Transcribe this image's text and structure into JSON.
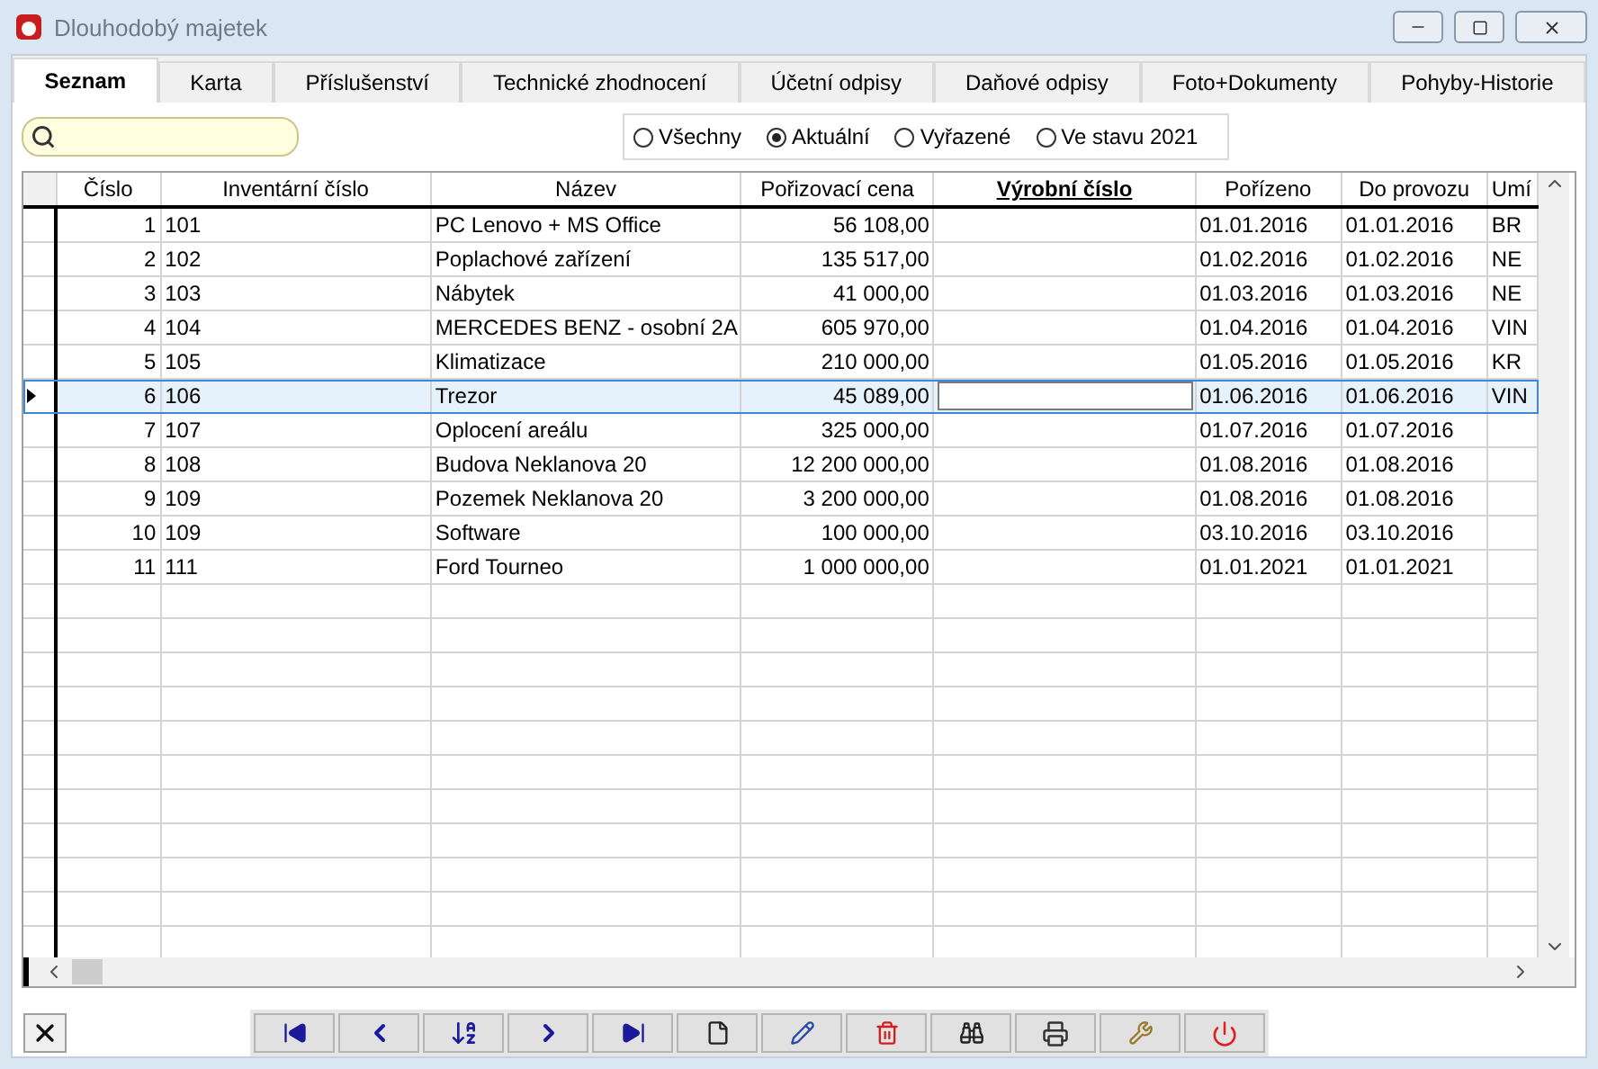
{
  "window": {
    "title": "Dlouhodobý majetek"
  },
  "tabs": [
    {
      "label": "Seznam",
      "selected": true
    },
    {
      "label": "Karta",
      "selected": false
    },
    {
      "label": "Příslušenství",
      "selected": false
    },
    {
      "label": "Technické zhodnocení",
      "selected": false
    },
    {
      "label": "Účetní odpisy",
      "selected": false
    },
    {
      "label": "Daňové odpisy",
      "selected": false
    },
    {
      "label": "Foto+Dokumenty",
      "selected": false
    },
    {
      "label": "Pohyby-Historie",
      "selected": false
    }
  ],
  "filter": [
    {
      "label": "Všechny",
      "selected": false
    },
    {
      "label": "Aktuální",
      "selected": true
    },
    {
      "label": "Vyřazené",
      "selected": false
    },
    {
      "label": "Ve stavu 2021",
      "selected": false
    }
  ],
  "table": {
    "columns": [
      {
        "label": "Číslo",
        "sorted": false
      },
      {
        "label": "Inventární číslo",
        "sorted": false
      },
      {
        "label": "Název",
        "sorted": false
      },
      {
        "label": "Pořizovací cena",
        "sorted": false
      },
      {
        "label": "Výrobní číslo",
        "sorted": true
      },
      {
        "label": "Pořízeno",
        "sorted": false
      },
      {
        "label": "Do provozu",
        "sorted": false
      },
      {
        "label": "Umí",
        "sorted": false
      }
    ],
    "rows": [
      {
        "selected": false,
        "cells": [
          "1",
          "101",
          "PC Lenovo + MS Office",
          "56 108,00",
          "",
          "01.01.2016",
          "01.01.2016",
          "BR"
        ]
      },
      {
        "selected": false,
        "cells": [
          "2",
          "102",
          "Poplachové zařízení",
          "135 517,00",
          "",
          "01.02.2016",
          "01.02.2016",
          "NE"
        ]
      },
      {
        "selected": false,
        "cells": [
          "3",
          "103",
          "Nábytek",
          "41 000,00",
          "",
          "01.03.2016",
          "01.03.2016",
          "NE"
        ]
      },
      {
        "selected": false,
        "cells": [
          "4",
          "104",
          "MERCEDES BENZ - osobní 2A",
          "605 970,00",
          "",
          "01.04.2016",
          "01.04.2016",
          "VIN"
        ]
      },
      {
        "selected": false,
        "cells": [
          "5",
          "105",
          "Klimatizace",
          "210 000,00",
          "",
          "01.05.2016",
          "01.05.2016",
          "KR"
        ]
      },
      {
        "selected": true,
        "cells": [
          "6",
          "106",
          "Trezor",
          "45 089,00",
          "",
          "01.06.2016",
          "01.06.2016",
          "VIN"
        ]
      },
      {
        "selected": false,
        "cells": [
          "7",
          "107",
          "Oplocení areálu",
          "325 000,00",
          "",
          "01.07.2016",
          "01.07.2016",
          ""
        ]
      },
      {
        "selected": false,
        "cells": [
          "8",
          "108",
          "Budova Neklanova 20",
          "12 200 000,00",
          "",
          "01.08.2016",
          "01.08.2016",
          ""
        ]
      },
      {
        "selected": false,
        "cells": [
          "9",
          "109",
          "Pozemek Neklanova 20",
          "3 200 000,00",
          "",
          "01.08.2016",
          "01.08.2016",
          ""
        ]
      },
      {
        "selected": false,
        "cells": [
          "10",
          "109",
          "Software",
          "100 000,00",
          "",
          "03.10.2016",
          "03.10.2016",
          ""
        ]
      },
      {
        "selected": false,
        "cells": [
          "11",
          "111",
          "Ford Tourneo",
          "1 000 000,00",
          "",
          "01.01.2021",
          "01.01.2021",
          ""
        ]
      }
    ]
  }
}
